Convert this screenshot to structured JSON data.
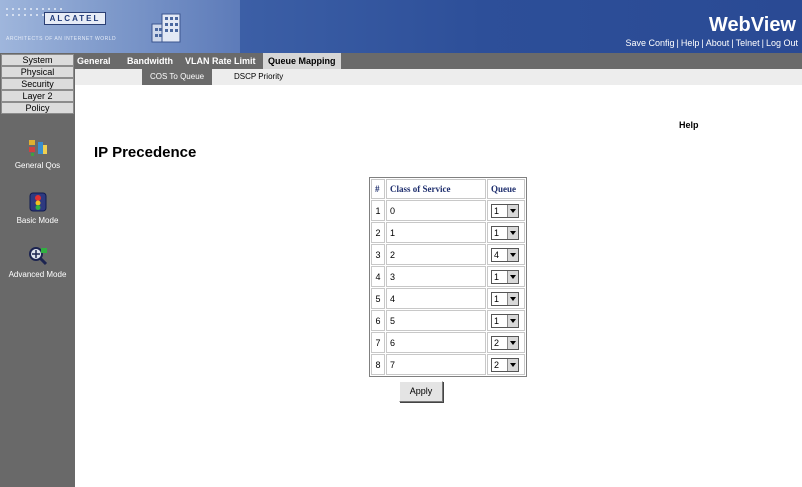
{
  "header": {
    "brand_word": "ALCATEL",
    "brand_sub": "ARCHITECTS OF AN INTERNET WORLD",
    "app_title": "WebView",
    "links": [
      "Save Config",
      "Help",
      "About",
      "Telnet",
      "Log Out"
    ],
    "link_separator": "|"
  },
  "sidebar": {
    "items": [
      {
        "label": "System"
      },
      {
        "label": "Physical"
      },
      {
        "label": "Security"
      },
      {
        "label": "Layer 2"
      },
      {
        "label": "Policy"
      }
    ],
    "modes": [
      {
        "label": "General Qos",
        "icon": "general-qos-icon"
      },
      {
        "label": "Basic Mode",
        "icon": "basic-mode-icon"
      },
      {
        "label": "Advanced Mode",
        "icon": "advanced-mode-icon"
      }
    ]
  },
  "tabs": [
    {
      "label": "General",
      "active": false
    },
    {
      "label": "Bandwidth",
      "active": false
    },
    {
      "label": "VLAN Rate Limit",
      "active": false
    },
    {
      "label": "Queue Mapping",
      "active": true
    }
  ],
  "subtabs": [
    {
      "label": "COS To Queue",
      "active": true
    },
    {
      "label": "DSCP Priority",
      "active": false
    }
  ],
  "help_label": "Help",
  "page_title": "IP Precedence",
  "table": {
    "headers": [
      "#",
      "Class of Service",
      "Queue"
    ],
    "rows": [
      {
        "num": "1",
        "cos": "0",
        "queue": "1"
      },
      {
        "num": "2",
        "cos": "1",
        "queue": "1"
      },
      {
        "num": "3",
        "cos": "2",
        "queue": "4"
      },
      {
        "num": "4",
        "cos": "3",
        "queue": "1"
      },
      {
        "num": "5",
        "cos": "4",
        "queue": "1"
      },
      {
        "num": "6",
        "cos": "5",
        "queue": "1"
      },
      {
        "num": "7",
        "cos": "6",
        "queue": "2"
      },
      {
        "num": "8",
        "cos": "7",
        "queue": "2"
      }
    ]
  },
  "apply_label": "Apply",
  "colors": {
    "header_blue": "#2d4f99",
    "sidebar_gray": "#696969",
    "tabbar_gray": "#6a6a6a"
  }
}
